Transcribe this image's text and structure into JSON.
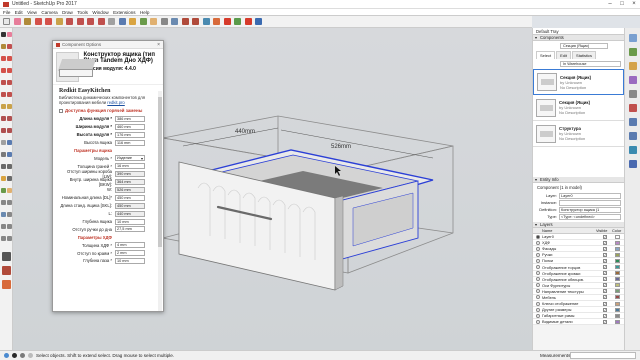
{
  "window": {
    "title": "Untitled - SketchUp Pro 2017"
  },
  "menu": [
    "File",
    "Edit",
    "View",
    "Camera",
    "Draw",
    "Tools",
    "Window",
    "Extensions",
    "Help"
  ],
  "dialog": {
    "title": "Component Options",
    "heading": "Конструктор ящика (тип Blum Tandem Дно ХДФ)",
    "version": "Версия модуля: 4.4.0",
    "brand": "Redkit EasyKitchen",
    "description": "Библиотека динамических компонентов для проектирования мебели",
    "link": "redkit.pro",
    "checkbox_label": "Доступна функция горячей замены",
    "rows": [
      {
        "label": "Длина модуля *",
        "value": "386 mm",
        "style": "b"
      },
      {
        "label": "Ширина модуля *",
        "value": "460 mm",
        "style": "b"
      },
      {
        "label": "Высота модуля *",
        "value": "176 mm",
        "style": "b"
      },
      {
        "label": "Высота ящика",
        "value": "116 mm",
        "style": ""
      },
      {
        "label": "Параметры ящика",
        "value": "",
        "style": "red"
      },
      {
        "label": "Модель *",
        "value": "Изделие",
        "style": "",
        "dd": true
      },
      {
        "label": "Толщина граней *",
        "value": "16 mm",
        "style": ""
      },
      {
        "label": "Отступ ширины короба [LW]:",
        "value": "390 mm",
        "style": ""
      },
      {
        "label": "Внутр. ширина ящика [BKW]:",
        "value": "364 mm",
        "style": ""
      },
      {
        "label": "W:",
        "value": "526 mm",
        "style": ""
      },
      {
        "label": "Номинальная длина [DL]*",
        "value": "450 mm",
        "style": ""
      },
      {
        "label": "Длина станд. ящика [SKL]:",
        "value": "450 mm",
        "style": ""
      },
      {
        "label": "L:",
        "value": "440 mm",
        "style": ""
      },
      {
        "label": "Глубина ящика",
        "value": "10 mm",
        "style": ""
      },
      {
        "label": "Отступ ручки до дна",
        "value": "27,5 mm",
        "style": ""
      },
      {
        "label": "Параметры ХДФ",
        "value": "",
        "style": "red"
      },
      {
        "label": "Толщина ХДФ *",
        "value": "4 mm",
        "style": ""
      },
      {
        "label": "Отступ по краям *",
        "value": "2 mm",
        "style": ""
      },
      {
        "label": "Глубина паза *",
        "value": "10 mm",
        "style": ""
      }
    ],
    "ok_label": "Apply"
  },
  "viewport": {
    "dim_width": "440mm",
    "dim_depth": "526mm"
  },
  "tray": {
    "title": "Default Tray",
    "components_section": "Components",
    "search_value": "Секция (Ящик)",
    "tabs": [
      "Select",
      "Edit",
      "Statistics"
    ],
    "filter": "In Warehouse",
    "items": [
      {
        "name": "Секция (Ящик)",
        "by": "by Unknown",
        "desc": "No Description"
      },
      {
        "name": "Секция (Ящик)",
        "by": "by Unknown",
        "desc": "No Description"
      },
      {
        "name": "Структура",
        "by": "by Unknown",
        "desc": "No Description"
      }
    ],
    "entity_section": "Entity Info",
    "entity_title": "Component (1 in model)",
    "entity_fields": [
      {
        "key": "Layer:",
        "value": "Layer0"
      },
      {
        "key": "Instance:",
        "value": ""
      },
      {
        "key": "Definition:",
        "value": "Конструктор ящика (1"
      },
      {
        "key": "Type:",
        "value": "<Type: <undefined>"
      }
    ],
    "layers_section": "Layers",
    "layers_head": {
      "name": "Name",
      "visible": "Visible",
      "color": "Color"
    },
    "layers": [
      {
        "name": "Layer0",
        "color": "#ffffff"
      },
      {
        "name": "ХДФ",
        "color": "#b98ac6"
      },
      {
        "name": "Фасады",
        "color": "#8aa7c6"
      },
      {
        "name": "Ручки",
        "color": "#9aa35a"
      },
      {
        "name": "Полки",
        "color": "#2e8b57"
      },
      {
        "name": "Отображение торцов",
        "color": "#3a9a9a"
      },
      {
        "name": "Отображение кромки",
        "color": "#9a6a3a"
      },
      {
        "name": "Отображение облицов.",
        "color": "#6a6a9a"
      },
      {
        "name": "Оси Фурнитуры",
        "color": "#c0c07a"
      },
      {
        "name": "Направление текстуры",
        "color": "#7aa07a"
      },
      {
        "name": "Мебель",
        "color": "#9a4a4a"
      },
      {
        "name": "Ключи отображение",
        "color": "#caa07a"
      },
      {
        "name": "Другие размеры",
        "color": "#4a7a9a"
      },
      {
        "name": "Габаритные рамы",
        "color": "#8a8a8a"
      },
      {
        "name": "Видимые детали",
        "color": "#a07ac0"
      }
    ]
  },
  "status": {
    "hint": "Select objects. Shift to extend select. Drag mouse to select multiple.",
    "measurements_label": "Measurements",
    "measurements_value": ""
  }
}
